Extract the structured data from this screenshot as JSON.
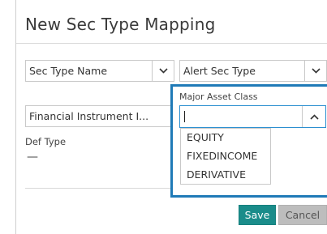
{
  "dialog": {
    "title": "New Sec Type Mapping"
  },
  "fields": {
    "sec_type_name": {
      "value": "Sec Type Name"
    },
    "alert_sec_type": {
      "value": "Alert Sec Type"
    },
    "major_asset_class": {
      "label": "Major Asset Class",
      "value": ""
    },
    "financial_instrument": {
      "value": "Financial Instrument I..."
    },
    "def_type": {
      "label": "Def Type",
      "value": "—"
    }
  },
  "dropdown": {
    "options": [
      "EQUITY",
      "FIXEDINCOME",
      "DERIVATIVE"
    ]
  },
  "buttons": {
    "save": "Save",
    "cancel": "Cancel"
  },
  "icons": {
    "chevron_down": "chevron-down-icon",
    "chevron_up": "chevron-up-icon"
  }
}
